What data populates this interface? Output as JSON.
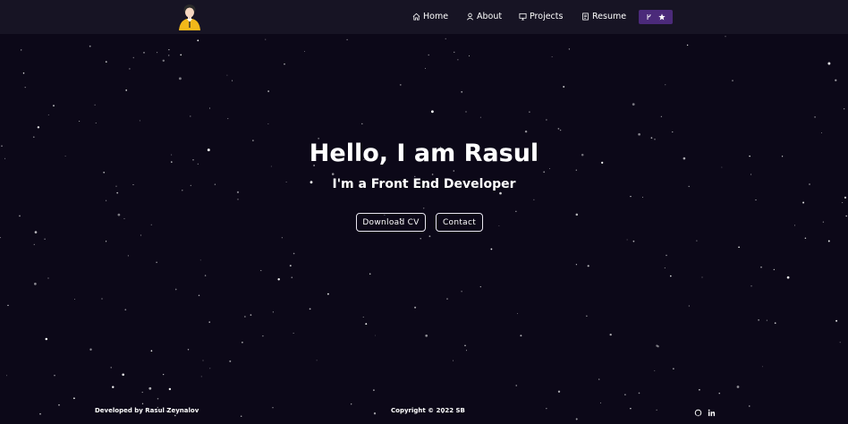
{
  "nav": {
    "logo_icon": "avatar-logo-icon",
    "items": [
      {
        "label": "Home",
        "icon": "home-icon"
      },
      {
        "label": "About",
        "icon": "user-icon"
      },
      {
        "label": "Projects",
        "icon": "monitor-icon"
      },
      {
        "label": "Resume",
        "icon": "document-icon"
      }
    ],
    "github_button": {
      "icons": [
        "fork-icon",
        "star-icon"
      ],
      "color": "#4b2a7a"
    }
  },
  "hero": {
    "title": "Hello, I am Rasul",
    "subtitle": "I'm a Front End Developer",
    "download_cv_label": "Download CV",
    "contact_label": "Contact"
  },
  "footer": {
    "developed_by": "Developed by Rasul Zeynalov",
    "copyright": "Copyright © 2022 SB",
    "social_icons": [
      "github-icon",
      "linkedin-icon"
    ]
  },
  "colors": {
    "background": "#0c0818",
    "navbar": "#171424",
    "accent": "#4b2a7a"
  }
}
